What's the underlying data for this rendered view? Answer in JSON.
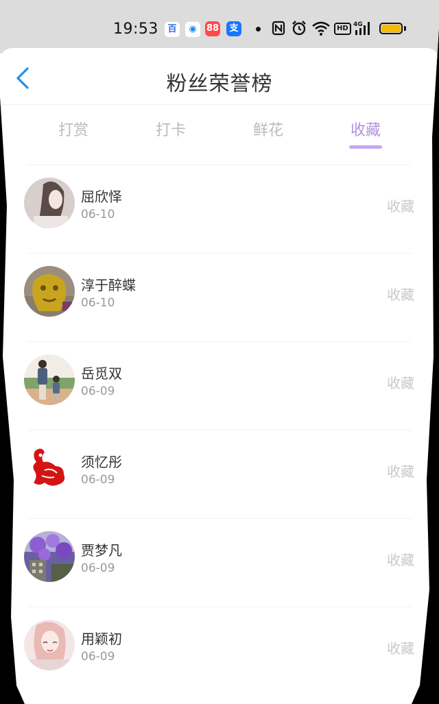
{
  "status_bar": {
    "time": "19:53",
    "notification_icons": [
      {
        "name": "baidu-icon",
        "glyph": "百",
        "color": "#2f6fde"
      },
      {
        "name": "browser-icon",
        "glyph": "◉",
        "color": "#1e88e5"
      },
      {
        "name": "app-icon",
        "glyph": "88",
        "color": "#ff4a4a"
      },
      {
        "name": "alipay-icon",
        "glyph": "支",
        "color": "#1677ff"
      }
    ],
    "network": "HD",
    "signal": "4G"
  },
  "header": {
    "title": "粉丝荣誉榜"
  },
  "tabs": [
    {
      "label": "打赏",
      "active": false
    },
    {
      "label": "打卡",
      "active": false
    },
    {
      "label": "鲜花",
      "active": false
    },
    {
      "label": "收藏",
      "active": true
    }
  ],
  "fans": [
    {
      "name": "屈欣怿",
      "date": "06-10",
      "action": "收藏"
    },
    {
      "name": "淳于醉蝶",
      "date": "06-10",
      "action": "收藏"
    },
    {
      "name": "岳觅双",
      "date": "06-09",
      "action": "收藏"
    },
    {
      "name": "须忆彤",
      "date": "06-09",
      "action": "收藏"
    },
    {
      "name": "贾梦凡",
      "date": "06-09",
      "action": "收藏"
    },
    {
      "name": "用颖初",
      "date": "06-09",
      "action": "收藏"
    }
  ],
  "colors": {
    "accent": "#b591e3",
    "back_arrow": "#1e90e8",
    "battery": "#f6b800"
  }
}
